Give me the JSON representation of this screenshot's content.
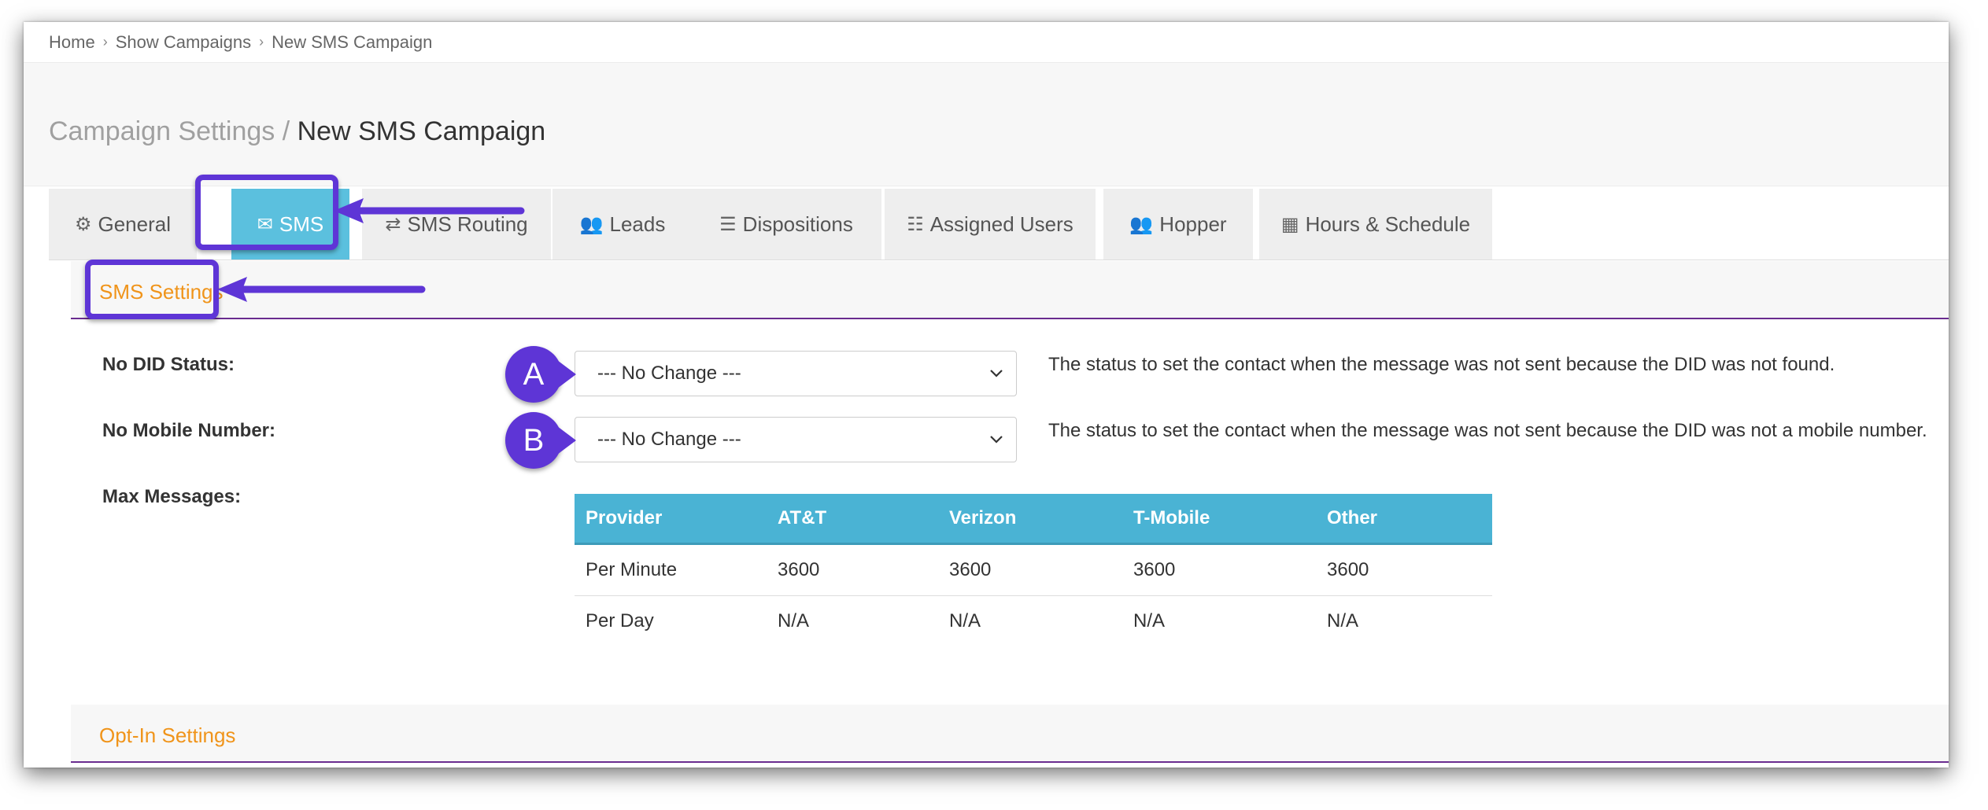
{
  "breadcrumb": [
    "Home",
    "Show Campaigns",
    "New SMS Campaign"
  ],
  "page_title": {
    "section": "Campaign Settings",
    "separator": " / ",
    "name": "New SMS Campaign"
  },
  "tabs": [
    {
      "label": "General",
      "icon": "gears-icon",
      "glyph": "⚙"
    },
    {
      "label": "SMS",
      "icon": "envelope-icon",
      "glyph": "✉"
    },
    {
      "label": "SMS Routing",
      "icon": "routing-icon",
      "glyph": "⇄"
    },
    {
      "label": "Leads",
      "icon": "users-icon",
      "glyph": "👥"
    },
    {
      "label": "Dispositions",
      "icon": "list-icon",
      "glyph": "☰"
    },
    {
      "label": "Assigned Users",
      "icon": "ordered-list-icon",
      "glyph": "☷"
    },
    {
      "label": "Hopper",
      "icon": "users-icon",
      "glyph": "👥"
    },
    {
      "label": "Hours & Schedule",
      "icon": "calendar-icon",
      "glyph": "▦"
    }
  ],
  "sms_settings": {
    "title": "SMS Settings",
    "no_did_status": {
      "label": "No DID Status:",
      "value": "--- No Change ---",
      "help": "The status to set the contact when the message was not sent because the DID was not found.",
      "badge": "A"
    },
    "no_mobile_number": {
      "label": "No Mobile Number:",
      "value": "--- No Change ---",
      "help": "The status to set the contact when the message was not sent because the DID was not a mobile number.",
      "badge": "B"
    },
    "max_messages": {
      "label": "Max Messages:",
      "columns": [
        "Provider",
        "AT&T",
        "Verizon",
        "T-Mobile",
        "Other"
      ],
      "rows": [
        [
          "Per Minute",
          "3600",
          "3600",
          "3600",
          "3600"
        ],
        [
          "Per Day",
          "N/A",
          "N/A",
          "N/A",
          "N/A"
        ]
      ]
    }
  },
  "opt_in_settings": {
    "title": "Opt-In Settings"
  },
  "colors": {
    "accent": "#5bc0de",
    "table_header": "#4ab3d4",
    "section_title": "#f0941a",
    "section_rule": "#6a2c8f",
    "annotation": "#5e35d6"
  }
}
